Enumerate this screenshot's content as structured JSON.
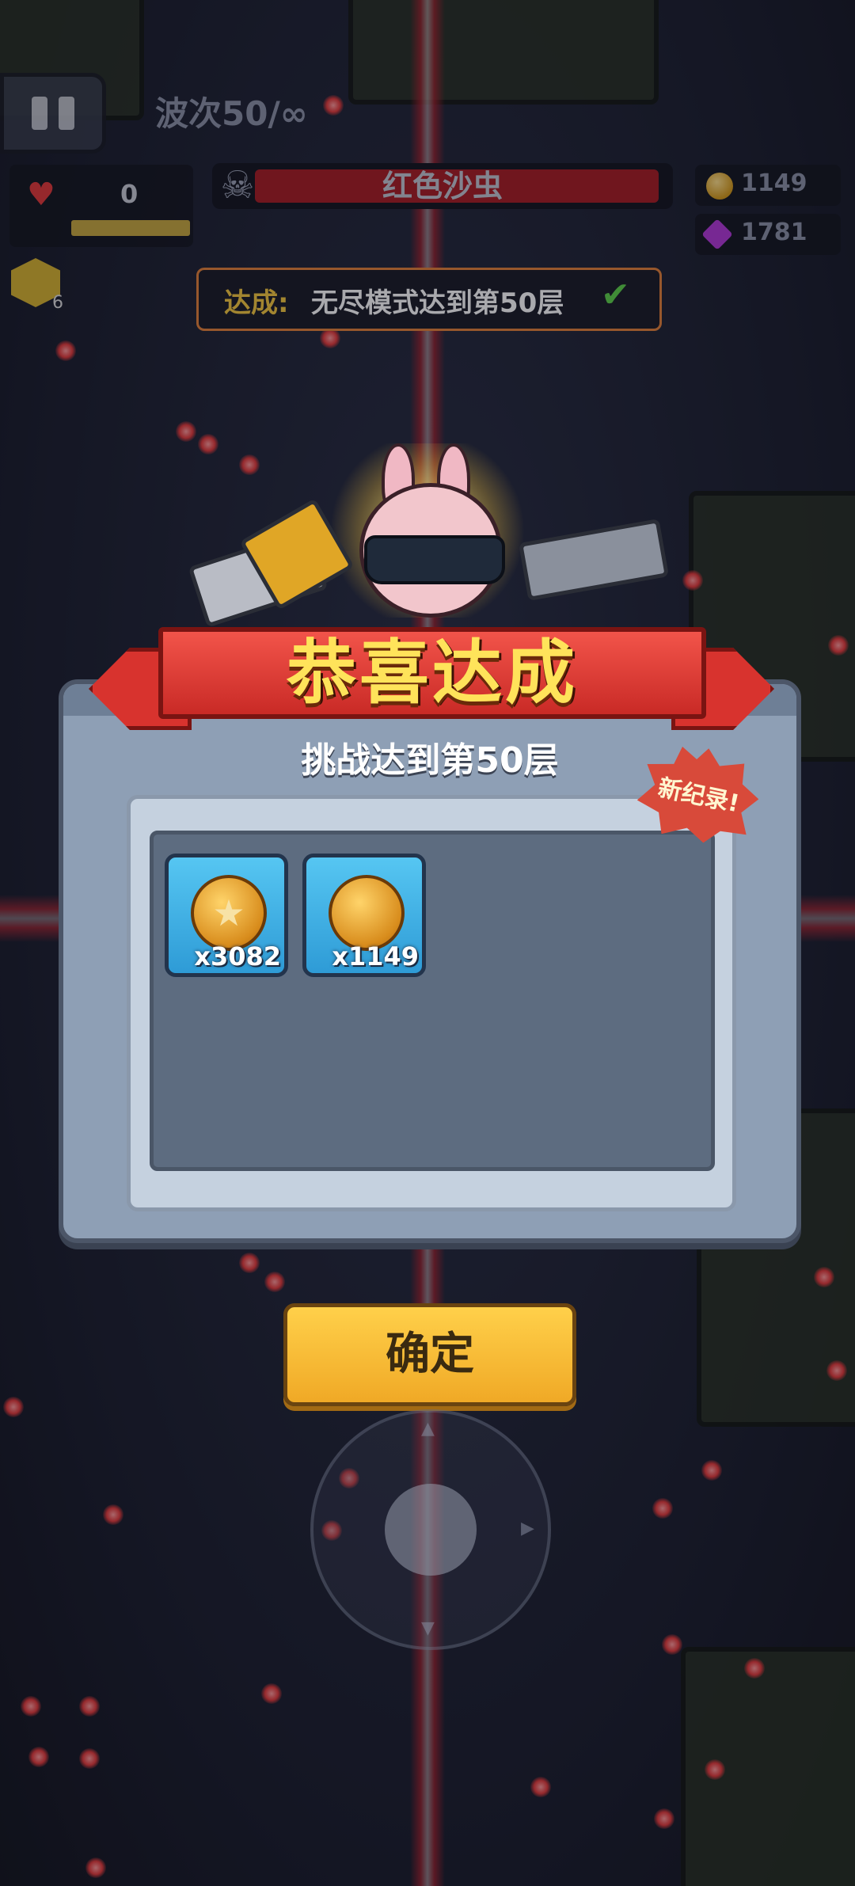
{
  "hud": {
    "wave_text": "波次50/∞",
    "hp_value": "0",
    "boss_name": "红色沙虫",
    "coins": "1149",
    "gems": "1781",
    "keys": "6"
  },
  "achievement": {
    "label": "达成:",
    "text": "无尽模式达到第50层"
  },
  "dialog": {
    "title": "恭喜达成",
    "subtitle": "挑战达到第50层",
    "record_badge": "新纪录!",
    "rewards": [
      {
        "icon": "star-medal-coin-icon",
        "qty": "x3082"
      },
      {
        "icon": "gold-coin-icon",
        "qty": "x1149"
      }
    ],
    "confirm_label": "确定"
  },
  "colors": {
    "ribbon": "#d8332e",
    "title_text": "#ffe35a",
    "panel": "#8e9fb5",
    "confirm_button": "#ffc83a",
    "achievement_border": "#e4823a",
    "check": "#5fd34b"
  }
}
